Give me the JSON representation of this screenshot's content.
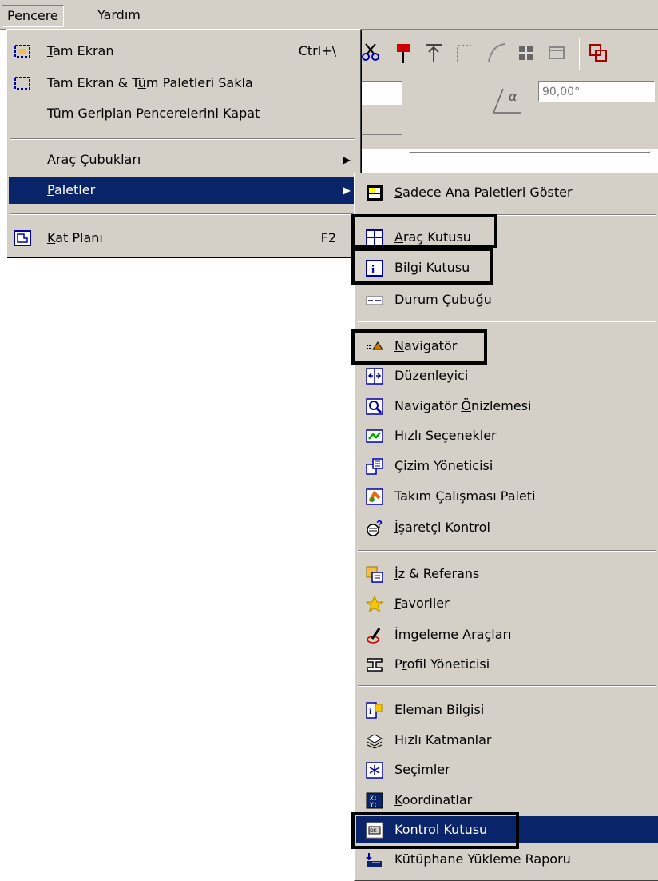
{
  "menubar": {
    "items": [
      "Pencere",
      "Yardım"
    ]
  },
  "toolbar": {
    "angle_value": "90,00°",
    "angle_symbol": "α"
  },
  "main_menu": {
    "items": [
      {
        "pre": "",
        "u": "T",
        "post": "am Ekran",
        "shortcut": "Ctrl+\\",
        "icon": "fullscreen-icon"
      },
      {
        "pre": "Tam Ekran & T",
        "u": "ü",
        "post": "m Paletleri Sakla",
        "shortcut": "",
        "icon": "fullscreen-hide-icon"
      },
      {
        "pre": "Tüm Geriplan Pencerelerini Kapat",
        "u": "",
        "post": "",
        "shortcut": ""
      },
      {
        "pre": "Araç Çubukları",
        "u": "",
        "post": "",
        "submenu": true
      },
      {
        "pre": "",
        "u": "P",
        "post": "aletler",
        "submenu": true,
        "highlighted": true
      },
      {
        "pre": "",
        "u": "K",
        "post": "at Planı",
        "shortcut": "F2",
        "icon": "floorplan-icon"
      }
    ]
  },
  "submenu": {
    "items": [
      {
        "pre": "",
        "u": "S",
        "post": "adece Ana Paletleri Göster",
        "icon": "main-palettes-icon"
      },
      {
        "pre": "",
        "u": "A",
        "post": "raç Kutusu",
        "icon": "toolbox-icon",
        "framed": true
      },
      {
        "pre": "",
        "u": "B",
        "post": "ilgi Kutusu",
        "icon": "info-box-icon",
        "framed": true
      },
      {
        "pre": "Durum ",
        "u": "Ç",
        "post": "ubuğu",
        "icon": "status-bar-icon"
      },
      {
        "pre": "",
        "u": "N",
        "post": "avigatör",
        "icon": "navigator-icon",
        "framed": true
      },
      {
        "pre": "",
        "u": "D",
        "post": "üzenleyici",
        "icon": "organizer-icon"
      },
      {
        "pre": "Navigatör ",
        "u": "Ö",
        "post": "nizlemesi",
        "icon": "navigator-preview-icon"
      },
      {
        "pre": "Hızlı Seçenekler",
        "u": "",
        "post": "",
        "icon": "quick-options-icon"
      },
      {
        "pre": "Çizim Yöneticisi",
        "u": "",
        "post": "",
        "icon": "drawing-manager-icon"
      },
      {
        "pre": "Takım Çalışması Paleti",
        "u": "",
        "post": "",
        "icon": "teamwork-icon"
      },
      {
        "pre": "",
        "u": "İ",
        "post": "şaretçi Kontrol",
        "icon": "marker-control-icon"
      },
      {
        "pre": "",
        "u": "İ",
        "post": "z & Referans",
        "icon": "trace-reference-icon"
      },
      {
        "pre": "",
        "u": "F",
        "post": "avoriler",
        "icon": "favorites-star-icon"
      },
      {
        "pre": "İ",
        "u": "m",
        "post": "geleme Araçları",
        "icon": "sketch-tools-icon"
      },
      {
        "pre": "P",
        "u": "r",
        "post": "ofil Yöneticisi",
        "icon": "profile-manager-icon"
      },
      {
        "pre": "Eleman Bilgisi",
        "u": "",
        "post": "",
        "icon": "element-info-icon"
      },
      {
        "pre": "Hızlı Katmanlar",
        "u": "",
        "post": "",
        "icon": "quick-layers-icon"
      },
      {
        "pre": "Seçimler",
        "u": "",
        "post": "",
        "icon": "selections-icon"
      },
      {
        "pre": "",
        "u": "K",
        "post": "oordinatlar",
        "icon": "coordinates-icon"
      },
      {
        "pre": "Kontrol Ku",
        "u": "t",
        "post": "usu",
        "icon": "control-box-icon",
        "framed": true,
        "highlighted": true
      },
      {
        "pre": "Kütüphane Yükleme Raporu",
        "u": "",
        "post": "",
        "icon": "library-report-icon"
      }
    ]
  }
}
